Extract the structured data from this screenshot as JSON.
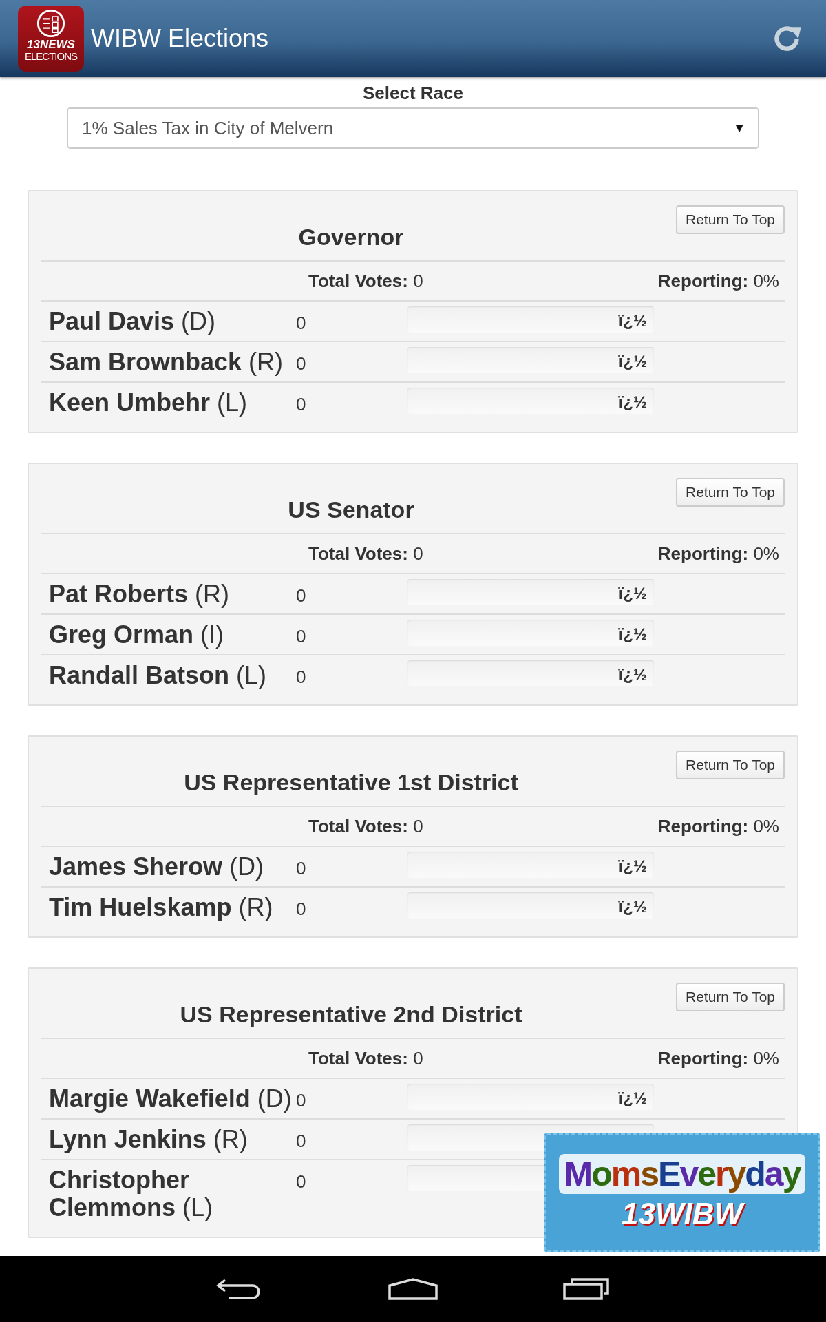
{
  "app_bar": {
    "logo_lines": [
      "13NEWS",
      "ELECTIONS"
    ],
    "title": "WIBW Elections"
  },
  "race_selector": {
    "label": "Select Race",
    "value": "1% Sales Tax in City of Melvern",
    "arrow": "▼"
  },
  "races": [
    {
      "title": "Governor",
      "button": "Return To Top",
      "total_label": "Total Votes:",
      "total": "0",
      "reporting_label": "Reporting:",
      "reporting": "0%",
      "candidates": [
        {
          "name": "Paul Davis",
          "party": "(D)",
          "votes": "0",
          "marker": "ï¿½"
        },
        {
          "name": "Sam Brownback",
          "party": "(R)",
          "votes": "0",
          "marker": "ï¿½"
        },
        {
          "name": "Keen Umbehr",
          "party": "(L)",
          "votes": "0",
          "marker": "ï¿½"
        }
      ]
    },
    {
      "title": "US Senator",
      "button": "Return To Top",
      "total_label": "Total Votes:",
      "total": "0",
      "reporting_label": "Reporting:",
      "reporting": "0%",
      "candidates": [
        {
          "name": "Pat Roberts",
          "party": "(R)",
          "votes": "0",
          "marker": "ï¿½"
        },
        {
          "name": "Greg Orman",
          "party": "(I)",
          "votes": "0",
          "marker": "ï¿½"
        },
        {
          "name": "Randall Batson",
          "party": "(L)",
          "votes": "0",
          "marker": "ï¿½"
        }
      ]
    },
    {
      "title": "US Representative 1st District",
      "button": "Return To Top",
      "total_label": "Total Votes:",
      "total": "0",
      "reporting_label": "Reporting:",
      "reporting": "0%",
      "candidates": [
        {
          "name": "James Sherow",
          "party": "(D)",
          "votes": "0",
          "marker": "ï¿½"
        },
        {
          "name": "Tim Huelskamp",
          "party": "(R)",
          "votes": "0",
          "marker": "ï¿½"
        }
      ]
    },
    {
      "title": "US Representative 2nd District",
      "button": "Return To Top",
      "total_label": "Total Votes:",
      "total": "0",
      "reporting_label": "Reporting:",
      "reporting": "0%",
      "candidates": [
        {
          "name": "Margie Wakefield",
          "party": "(D)",
          "votes": "0",
          "marker": "ï¿½"
        },
        {
          "name": "Lynn Jenkins",
          "party": "(R)",
          "votes": "0"
        },
        {
          "name": "Christopher Clemmons",
          "party": "(L)",
          "votes": "0"
        }
      ]
    }
  ],
  "ad": {
    "line_1": "MomsEveryday",
    "line_2": "13WIBW"
  }
}
